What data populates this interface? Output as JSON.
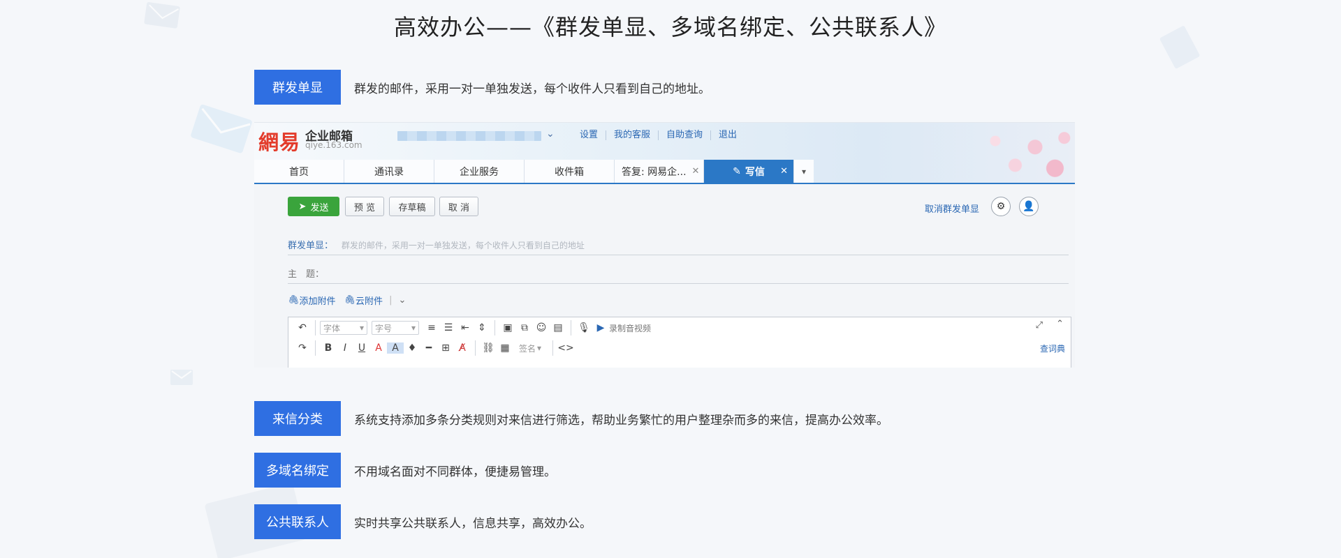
{
  "page": {
    "title": "高效办公——《群发单显、多域名绑定、公共联系人》"
  },
  "features": [
    {
      "badge": "群发单显",
      "desc": "群发的邮件，采用一对一单独发送，每个收件人只看到自己的地址。"
    },
    {
      "badge": "来信分类",
      "desc": "系统支持添加多条分类规则对来信进行筛选，帮助业务繁忙的用户整理杂而多的来信，提高办公效率。"
    },
    {
      "badge": "多域名绑定",
      "desc": "不用域名面对不同群体，便捷易管理。"
    },
    {
      "badge": "公共联系人",
      "desc": "实时共享公共联系人，信息共享，高效办公。"
    }
  ],
  "mail": {
    "logo_mark": "網易",
    "logo_name": "企业邮箱",
    "logo_url": "qiye.163.com",
    "top_links": [
      "设置",
      "我的客服",
      "自助查询",
      "退出"
    ],
    "tabs": [
      "首页",
      "通讯录",
      "企业服务",
      "收件箱"
    ],
    "reply_tab": "答复: 网易企...",
    "active_tab": "写信",
    "toolbar": {
      "send": "发送",
      "preview": "预 览",
      "draft": "存草稿",
      "cancel": "取 消",
      "cancel_group": "取消群发单显"
    },
    "group_label": "群发单显：",
    "group_hint": "群发的邮件，采用一对一单独发送，每个收件人只看到自己的地址",
    "subject_label": "主　题：",
    "attach": "添加附件",
    "cloud_attach": "云附件",
    "editor": {
      "font": "字体",
      "size": "字号",
      "record": "录制音视频",
      "signature": "签名",
      "dictionary": "查词典"
    }
  }
}
